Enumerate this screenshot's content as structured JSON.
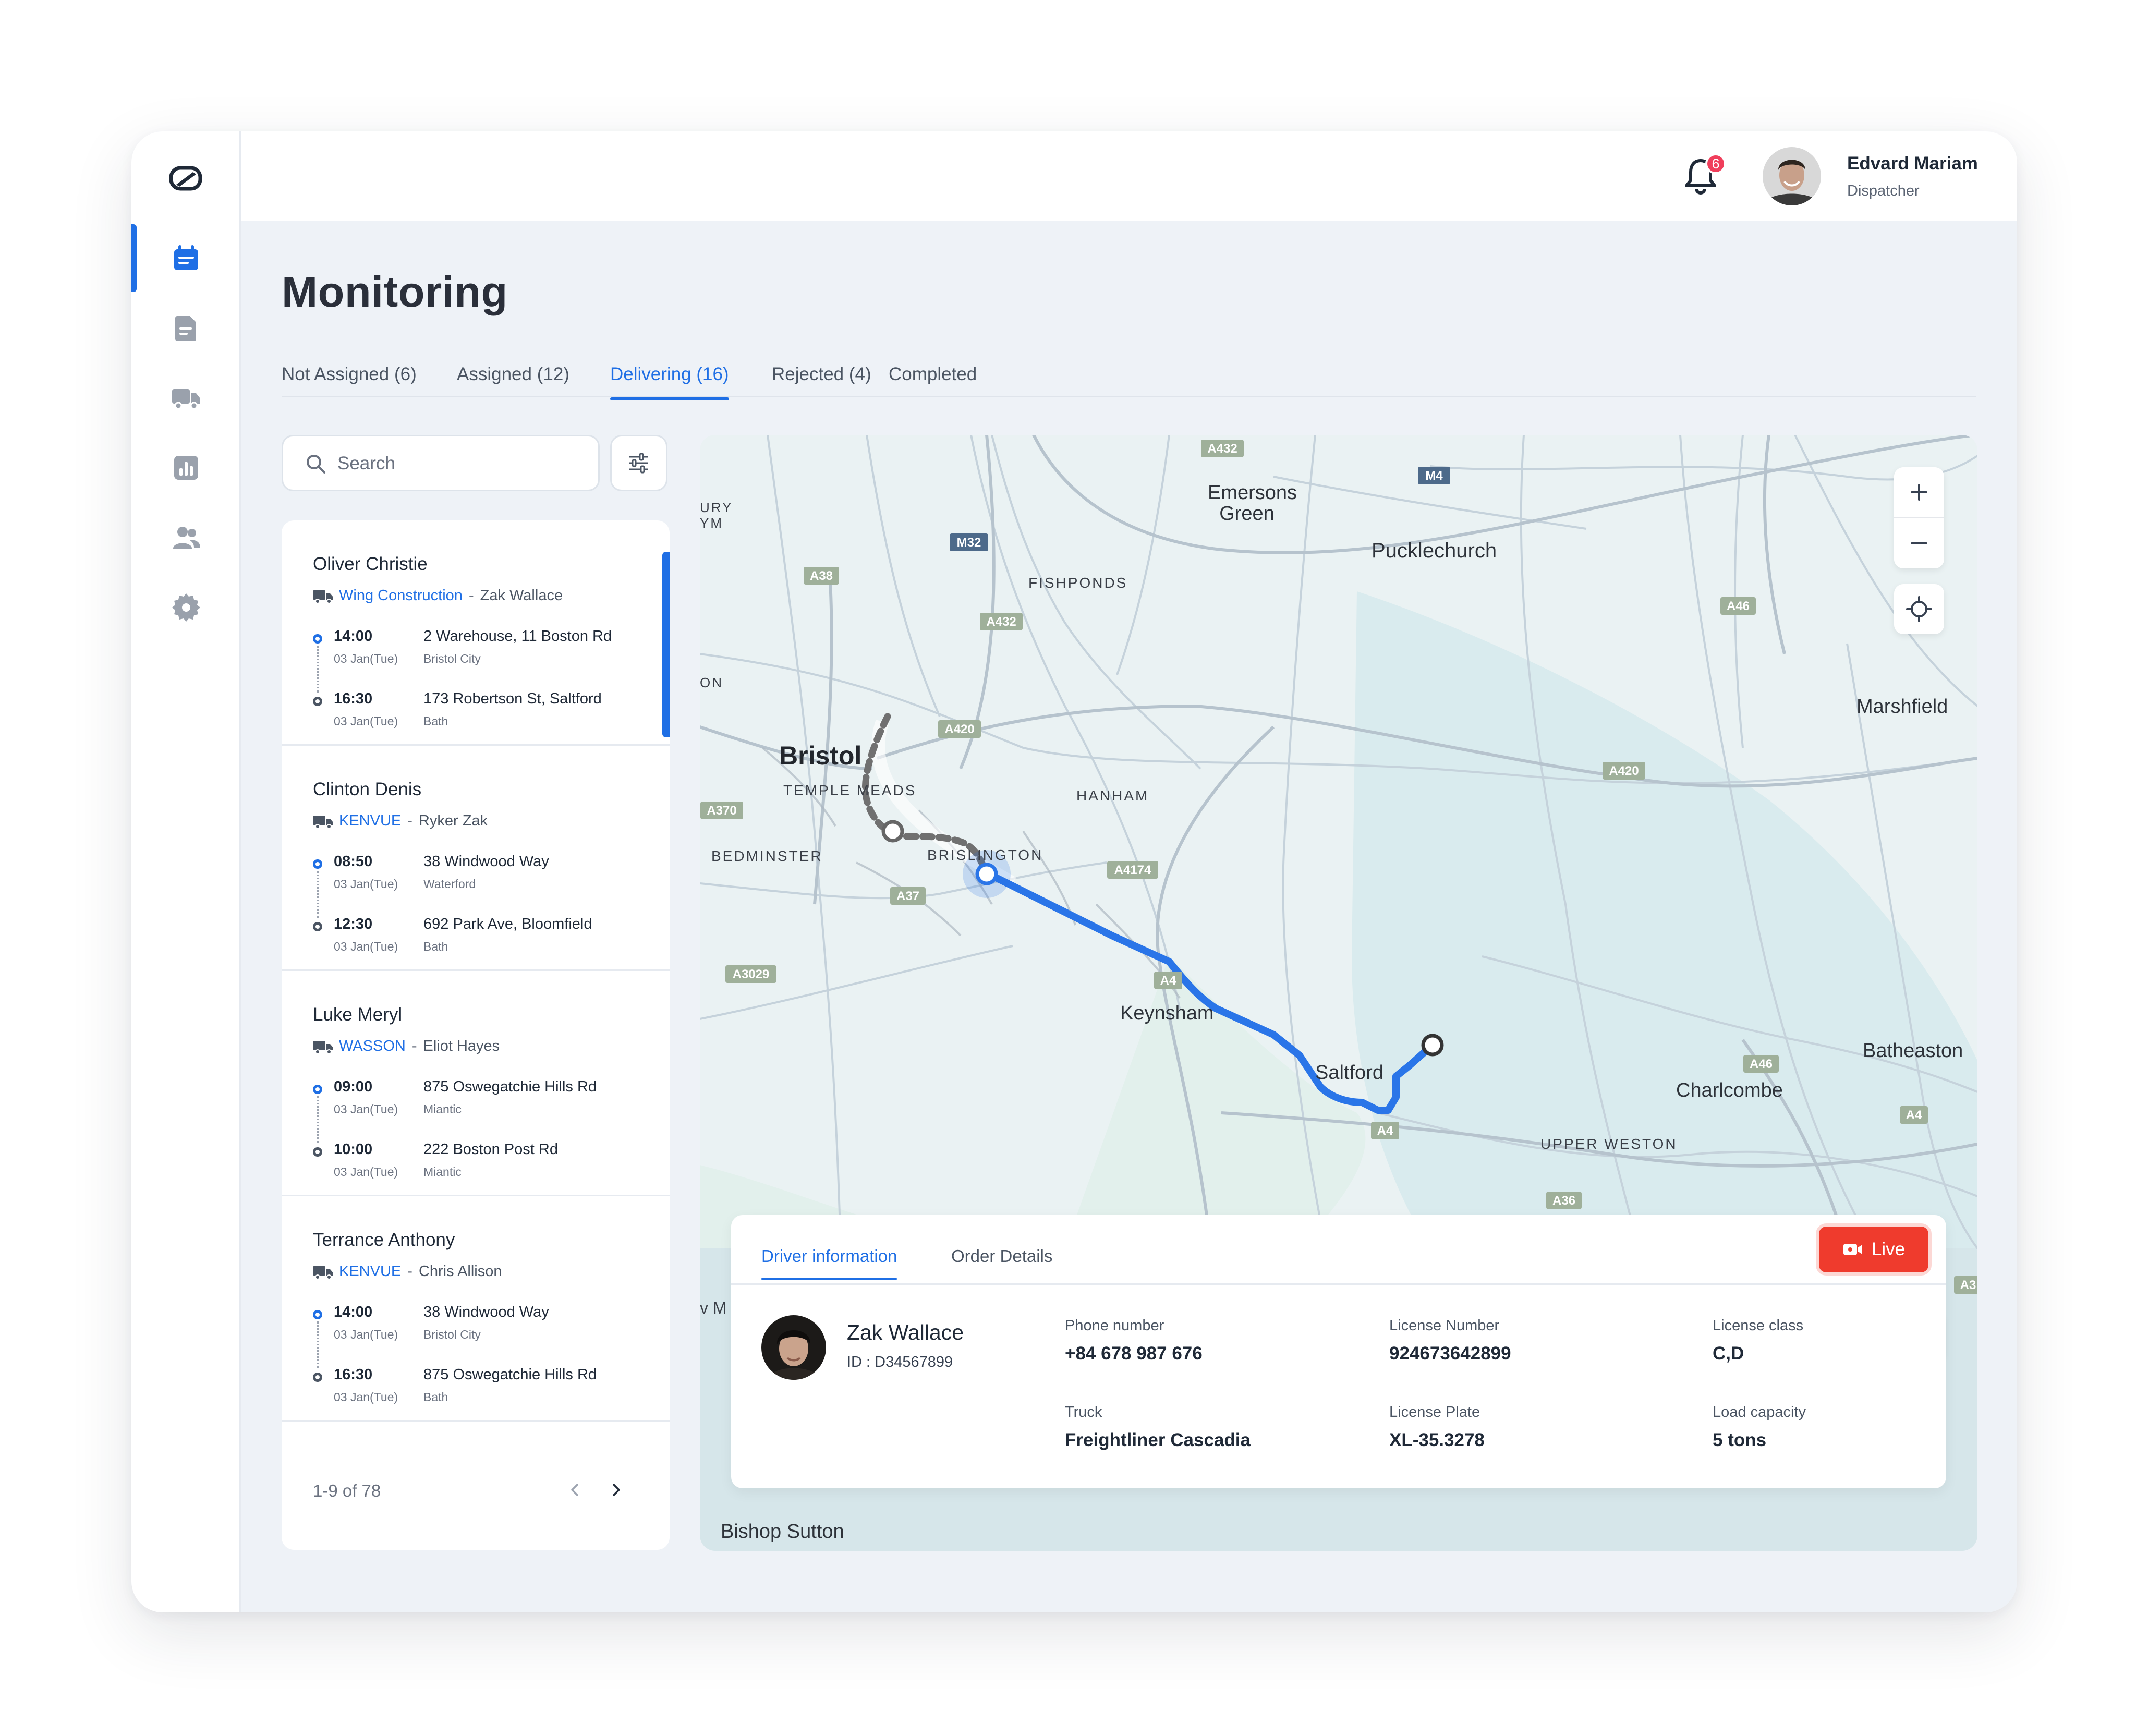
{
  "user": {
    "name": "Edvard Mariam",
    "role": "Dispatcher",
    "notifications": "6"
  },
  "nav": {
    "items": [
      "orders",
      "documents",
      "trucks",
      "reports",
      "drivers",
      "settings"
    ],
    "active": "orders"
  },
  "page": {
    "title": "Monitoring"
  },
  "tabs": [
    {
      "label": "Not Assigned (6)"
    },
    {
      "label": "Assigned (12)"
    },
    {
      "label": "Delivering (16)"
    },
    {
      "label": "Rejected (4)"
    },
    {
      "label": "Completed"
    }
  ],
  "active_tab": "Delivering (16)",
  "search": {
    "placeholder": "Search",
    "value": ""
  },
  "orders": [
    {
      "name": "Oliver Christie",
      "company": "Wing Construction",
      "driver": "Zak Wallace",
      "pickup": {
        "time": "14:00",
        "date": "03 Jan(Tue)",
        "address": "2 Warehouse, 11 Boston Rd",
        "city": "Bristol City"
      },
      "dropoff": {
        "time": "16:30",
        "date": "03 Jan(Tue)",
        "address": "173 Robertson St, Saltford",
        "city": "Bath"
      }
    },
    {
      "name": "Clinton Denis",
      "company": "KENVUE",
      "driver": "Ryker Zak",
      "pickup": {
        "time": "08:50",
        "date": "03 Jan(Tue)",
        "address": "38 Windwood Way",
        "city": "Waterford"
      },
      "dropoff": {
        "time": "12:30",
        "date": "03 Jan(Tue)",
        "address": "692 Park Ave, Bloomfield",
        "city": "Bath"
      }
    },
    {
      "name": "Luke Meryl",
      "company": "WASSON",
      "driver": "Eliot Hayes",
      "pickup": {
        "time": "09:00",
        "date": "03 Jan(Tue)",
        "address": "875 Oswegatchie Hills Rd",
        "city": "Miantic"
      },
      "dropoff": {
        "time": "10:00",
        "date": "03 Jan(Tue)",
        "address": "222 Boston Post Rd",
        "city": "Miantic"
      }
    },
    {
      "name": "Terrance Anthony",
      "company": "KENVUE",
      "driver": "Chris Allison",
      "pickup": {
        "time": "14:00",
        "date": "03 Jan(Tue)",
        "address": "38 Windwood Way",
        "city": "Bristol City"
      },
      "dropoff": {
        "time": "16:30",
        "date": "03 Jan(Tue)",
        "address": "875 Oswegatchie Hills Rd",
        "city": "Bath"
      }
    }
  ],
  "selected_order": "Oliver Christie",
  "separator": "-",
  "pagination": {
    "text": "1-9 of 78"
  },
  "map": {
    "labels": [
      "URY",
      "YM",
      "ON",
      "v M",
      "Emersons",
      "Green",
      "Pucklechurch",
      "FISHPONDS",
      "Bristol",
      "TEMPLE MEADS",
      "HANHAM",
      "BEDMINSTER",
      "BRISLINGTON",
      "Marshfield",
      "Keynsham",
      "Saltford",
      "Charlcombe",
      "Batheaston",
      "UPPER WESTON",
      "Bishop Sutton"
    ],
    "roads": [
      "A432",
      "M4",
      "M32",
      "A38",
      "A432",
      "A46",
      "A420",
      "A420",
      "A370",
      "A4174",
      "A37",
      "A46",
      "A3029",
      "A4",
      "A4",
      "A36",
      "A4",
      "A3"
    ]
  },
  "driver_panel": {
    "tabs": [
      "Driver information",
      "Order Details"
    ],
    "live_label": "Live",
    "name": "Zak Wallace",
    "id": "ID : D34567899",
    "fields": [
      {
        "label": "Phone number",
        "value": "+84 678 987 676"
      },
      {
        "label": "License Number",
        "value": "924673642899"
      },
      {
        "label": "License class",
        "value": "C,D"
      },
      {
        "label": "Truck",
        "value": "Freightliner Cascadia"
      },
      {
        "label": "License Plate",
        "value": "XL-35.3278"
      },
      {
        "label": "Load capacity",
        "value": "5 tons"
      }
    ]
  },
  "colors": {
    "accent": "#1f6fe5",
    "live": "#ef3b2d",
    "badge": "#f03e5b",
    "background": "#eef2f7"
  }
}
